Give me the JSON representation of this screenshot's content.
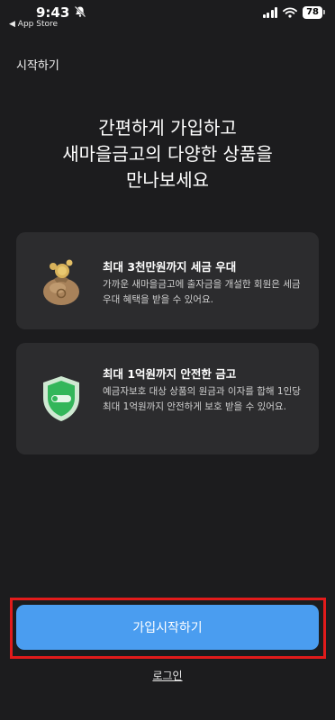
{
  "status_bar": {
    "time": "9:43",
    "back_label": "◀ App Store",
    "battery": "78",
    "icons": [
      "bell-off-icon",
      "signal-icon",
      "wifi-icon",
      "battery-icon"
    ]
  },
  "nav": {
    "title": "시작하기"
  },
  "headline": {
    "lines": [
      "간편하게 가입하고",
      "새마을금고의 다양한 상품을",
      "만나보세요"
    ]
  },
  "cards": [
    {
      "icon": "money-bag-icon",
      "title": "최대 3천만원까지 세금 우대",
      "desc": "가까운 새마을금고에 출자금을 개설한 회원은 세금우대 혜택을 받을 수 있어요."
    },
    {
      "icon": "shield-icon",
      "title": "최대 1억원까지 안전한 금고",
      "desc": "예금자보호 대상 상품의 원금과 이자를 합해 1인당 최대 1억원까지 안전하게 보호 받을 수 있어요."
    }
  ],
  "actions": {
    "signup_label": "가입시작하기",
    "login_label": "로그인"
  },
  "colors": {
    "background": "#1c1c1e",
    "card": "#2c2c2e",
    "primary_button": "#4a9df0",
    "highlight": "#e21b1b"
  }
}
